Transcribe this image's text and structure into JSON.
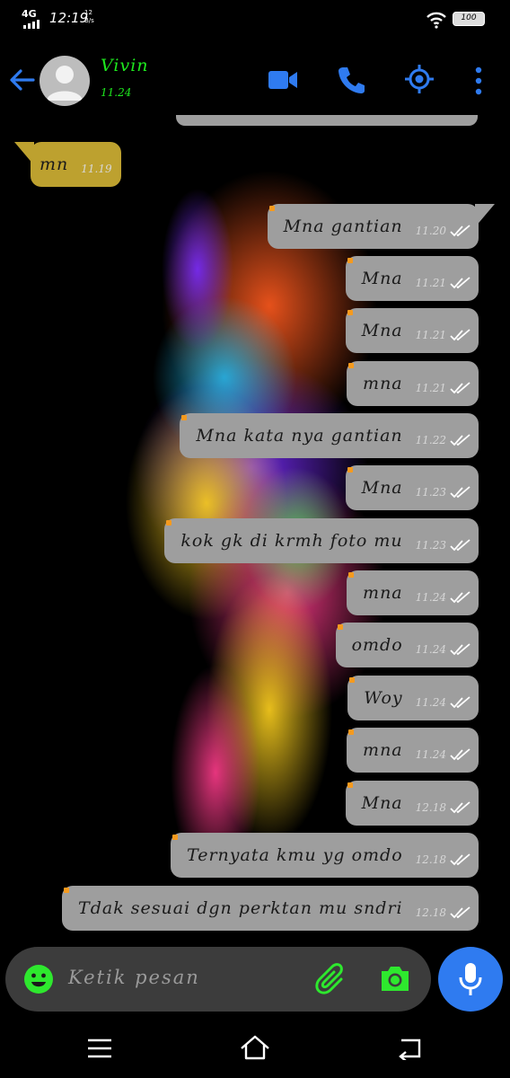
{
  "status_bar": {
    "network": "4G",
    "time": "12:19",
    "speed_value": "12",
    "speed_unit": "B/s",
    "battery": "100"
  },
  "contact": {
    "name": "Vivin",
    "status": "11.24"
  },
  "messages": [
    {
      "dir": "in",
      "text": "mn",
      "time": "11.19"
    },
    {
      "dir": "out",
      "text": "Mna gantian",
      "time": "11.20"
    },
    {
      "dir": "out",
      "text": "Mna",
      "time": "11.21"
    },
    {
      "dir": "out",
      "text": "Mna",
      "time": "11.21"
    },
    {
      "dir": "out",
      "text": "mna",
      "time": "11.21"
    },
    {
      "dir": "out",
      "text": "Mna kata nya gantian",
      "time": "11.22"
    },
    {
      "dir": "out",
      "text": "Mna",
      "time": "11.23"
    },
    {
      "dir": "out",
      "text": "kok gk di krmh foto mu",
      "time": "11.23"
    },
    {
      "dir": "out",
      "text": "mna",
      "time": "11.24"
    },
    {
      "dir": "out",
      "text": "omdo",
      "time": "11.24"
    },
    {
      "dir": "out",
      "text": "Woy",
      "time": "11.24"
    },
    {
      "dir": "out",
      "text": "mna",
      "time": "11.24"
    },
    {
      "dir": "out",
      "text": "Mna",
      "time": "12.18"
    },
    {
      "dir": "out",
      "text": "Ternyata kmu yg omdo",
      "time": "12.18"
    },
    {
      "dir": "out",
      "text": "Tdak sesuai dgn perktan mu sndri",
      "time": "12.18"
    }
  ],
  "composer": {
    "placeholder": "Ketik pesan"
  },
  "icons": {
    "back": "arrow-left-icon",
    "video": "video-camera-icon",
    "call": "phone-icon",
    "location": "location-target-icon",
    "more": "more-vertical-icon",
    "emoji": "smiley-icon",
    "attach": "paperclip-icon",
    "camera": "camera-icon",
    "mic": "microphone-icon"
  },
  "colors": {
    "accent_blue": "#2f7bf0",
    "contact_green": "#1ee81e",
    "outgoing_bubble": "#9e9e9e",
    "incoming_bubble": "#bda12f",
    "read_ticks": "#ffffff"
  }
}
